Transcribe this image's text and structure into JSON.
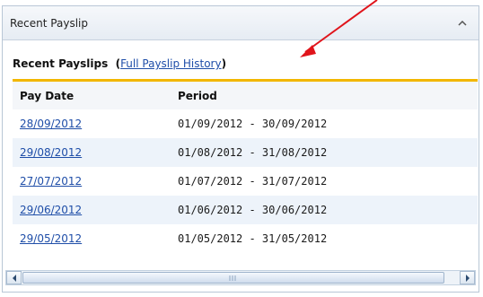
{
  "panel": {
    "title": "Recent Payslip",
    "collapse_icon": "chevron-up-icon"
  },
  "section": {
    "heading": "Recent Payslips",
    "open_paren": "(",
    "history_link": "Full Payslip History",
    "close_paren": ")"
  },
  "table": {
    "columns": [
      "Pay Date",
      "Period"
    ],
    "rows": [
      {
        "pay_date": "28/09/2012",
        "period": "01/09/2012 - 30/09/2012"
      },
      {
        "pay_date": "29/08/2012",
        "period": "01/08/2012 - 31/08/2012"
      },
      {
        "pay_date": "27/07/2012",
        "period": "01/07/2012 - 31/07/2012"
      },
      {
        "pay_date": "29/06/2012",
        "period": "01/06/2012 - 30/06/2012"
      },
      {
        "pay_date": "29/05/2012",
        "period": "01/05/2012 - 31/05/2012"
      }
    ]
  },
  "colors": {
    "header_underline": "#f2b700",
    "link": "#1f4ea8",
    "annotation_arrow": "#e0141b"
  }
}
